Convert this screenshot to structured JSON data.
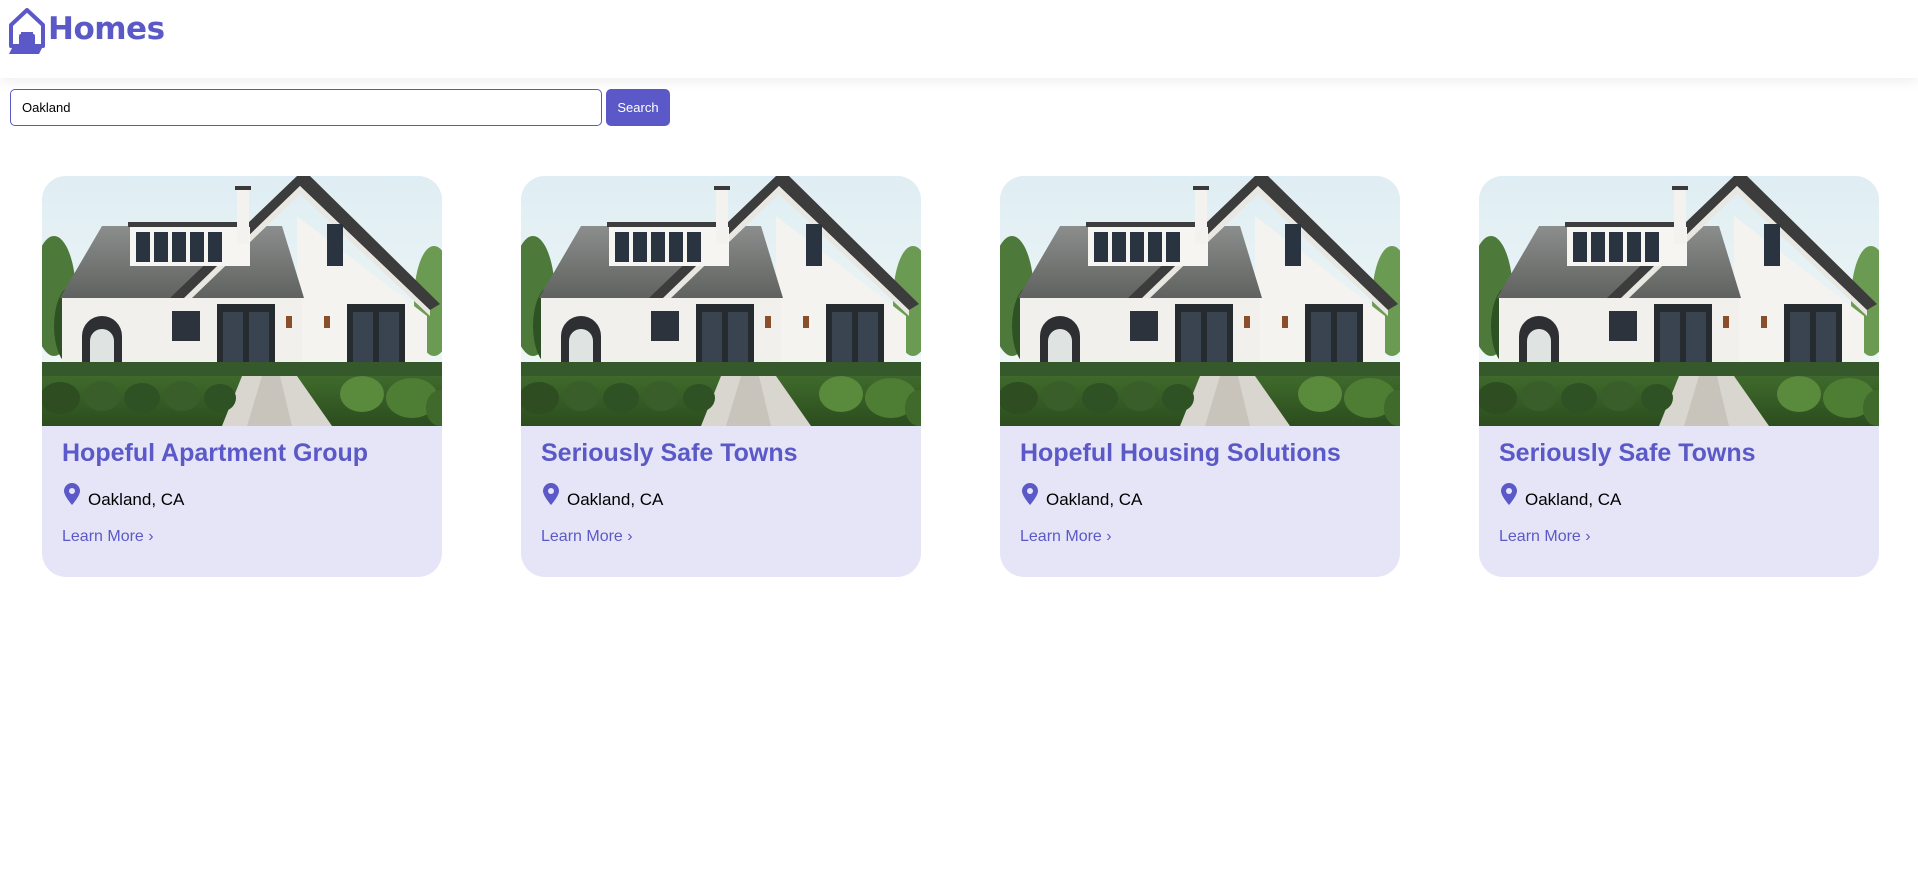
{
  "header": {
    "logo_text": "Homes",
    "logo_icon": "house-icon",
    "brand_color": "#5b59c7"
  },
  "search": {
    "value": "Oakland",
    "button_label": "Search"
  },
  "cards": [
    {
      "title": "Hopeful Apartment Group",
      "location": "Oakland, CA",
      "link_label": "Learn More ›",
      "image": "house-photo",
      "icon": "location-pin-icon"
    },
    {
      "title": "Seriously Safe Towns",
      "location": "Oakland, CA",
      "link_label": "Learn More ›",
      "image": "house-photo",
      "icon": "location-pin-icon"
    },
    {
      "title": "Hopeful Housing Solutions",
      "location": "Oakland, CA",
      "link_label": "Learn More ›",
      "image": "house-photo",
      "icon": "location-pin-icon"
    },
    {
      "title": "Seriously Safe Towns",
      "location": "Oakland, CA",
      "link_label": "Learn More ›",
      "image": "house-photo",
      "icon": "location-pin-icon"
    }
  ],
  "colors": {
    "accent": "#5b59c7",
    "card_background": "#e6e5f7"
  }
}
